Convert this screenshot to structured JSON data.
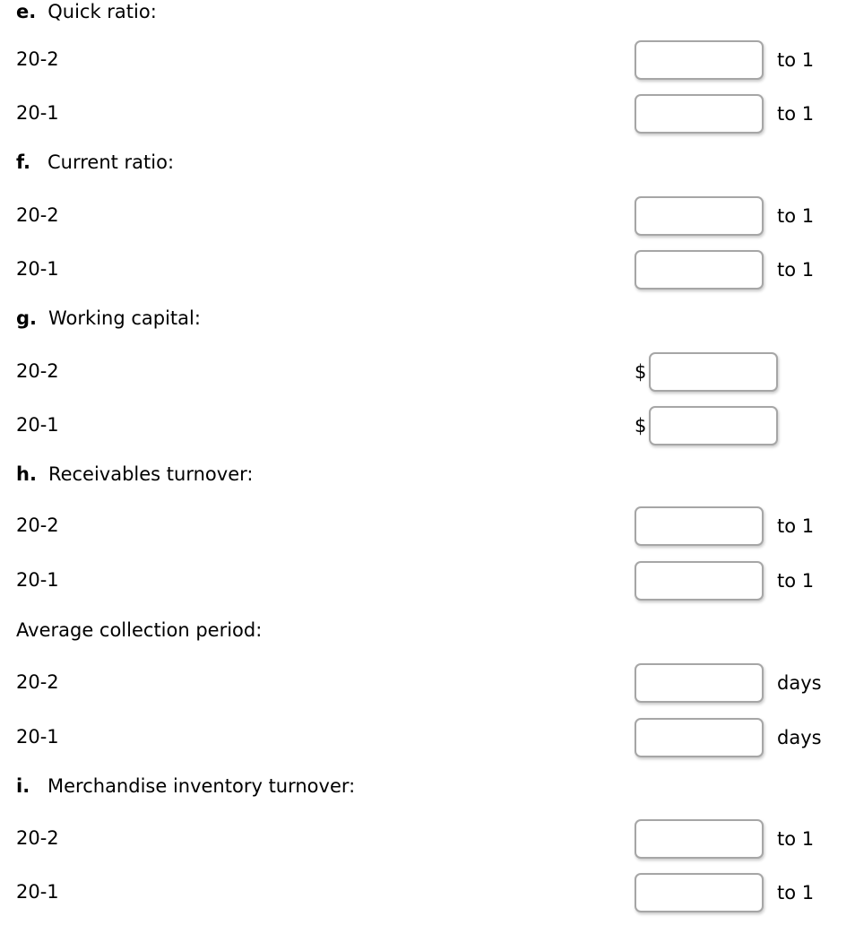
{
  "page": {
    "background": "#ffffff",
    "text_color": "#000000",
    "field_border_color": "#a6a6a6"
  },
  "sections": [
    {
      "letter": "e.",
      "title": "Quick ratio:",
      "rows": [
        {
          "label": "20-2",
          "prefix": "",
          "value": "",
          "unit": "to 1"
        },
        {
          "label": "20-1",
          "prefix": "",
          "value": "",
          "unit": "to 1"
        }
      ]
    },
    {
      "letter": "f.",
      "title": "Current ratio:",
      "rows": [
        {
          "label": "20-2",
          "prefix": "",
          "value": "",
          "unit": "to 1"
        },
        {
          "label": "20-1",
          "prefix": "",
          "value": "",
          "unit": "to 1"
        }
      ]
    },
    {
      "letter": "g.",
      "title": "Working capital:",
      "rows": [
        {
          "label": "20-2",
          "prefix": "$",
          "value": "",
          "unit": ""
        },
        {
          "label": "20-1",
          "prefix": "$",
          "value": "",
          "unit": ""
        }
      ]
    },
    {
      "letter": "h.",
      "title": "Receivables turnover:",
      "rows": [
        {
          "label": "20-2",
          "prefix": "",
          "value": "",
          "unit": "to 1"
        },
        {
          "label": "20-1",
          "prefix": "",
          "value": "",
          "unit": "to 1"
        }
      ]
    },
    {
      "letter": "",
      "title": "Average collection period:",
      "rows": [
        {
          "label": "20-2",
          "prefix": "",
          "value": "",
          "unit": "days"
        },
        {
          "label": "20-1",
          "prefix": "",
          "value": "",
          "unit": "days"
        }
      ]
    },
    {
      "letter": "i.",
      "title": "Merchandise inventory turnover:",
      "rows": [
        {
          "label": "20-2",
          "prefix": "",
          "value": "",
          "unit": "to 1"
        },
        {
          "label": "20-1",
          "prefix": "",
          "value": "",
          "unit": "to 1"
        }
      ]
    }
  ]
}
